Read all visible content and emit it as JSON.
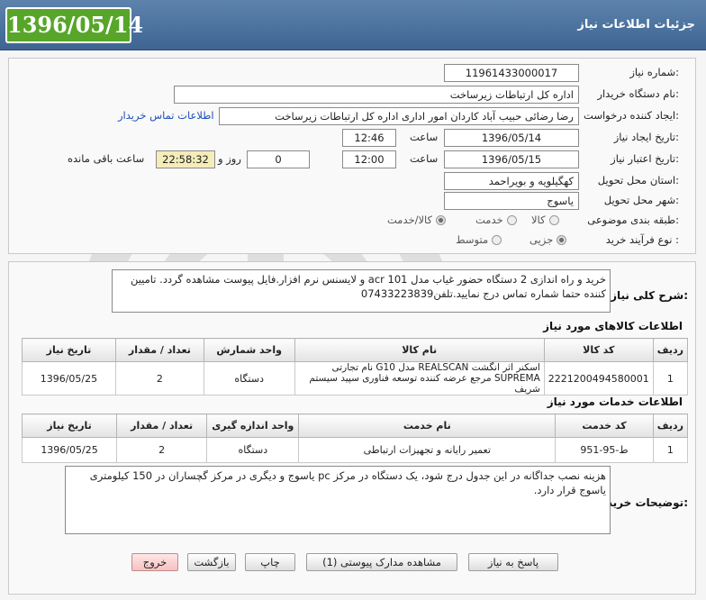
{
  "header": {
    "title": "جزئیات اطلاعات نیاز",
    "date_badge": "1396/05/14"
  },
  "form": {
    "need_number_label": "شماره نیاز:",
    "need_number": "11961433000017",
    "buyer_org_label": "نام دستگاه خریدار:",
    "buyer_org": "اداره کل ارتباطات زیرساخت",
    "requester_label": "ایجاد کننده درخواست:",
    "requester": "رضا رضائی حبیب آباد کاردان امور اداری اداره کل ارتباطات زیرساخت",
    "buyer_contact_link": "اطلاعات تماس خریدار",
    "created_label": "تاریخ ایجاد نیاز:",
    "created_date": "1396/05/14",
    "created_time_label": "ساعت",
    "created_time": "12:46",
    "deadline_label": "تاریخ اعتبار نیاز:",
    "deadline_date": "1396/05/15",
    "deadline_time_label": "ساعت",
    "deadline_time": "12:00",
    "days": "0",
    "days_label": "روز و",
    "remaining_time": "22:58:32",
    "remaining_label": "ساعت باقی مانده",
    "province_label": "استان محل تحویل:",
    "province": "کهگیلویه و بویراحمد",
    "city_label": "شهر محل تحویل:",
    "city": "یاسوج",
    "category_label": "طبقه بندی موضوعی:",
    "category_options": [
      "کالا",
      "خدمت",
      "کالا/خدمت"
    ],
    "category_selected": "کالا/خدمت",
    "purchase_process_label": "نوع فرآیند خرید :",
    "process_options": [
      "جزیی",
      "متوسط"
    ],
    "process_selected": "جزیی"
  },
  "summary": {
    "label": "شرح کلی نیاز:",
    "text": "خرید و راه اندازی 2 دستگاه حضور غیاب مدل acr 101 و لایسنس نرم افزار.فایل پیوست مشاهده گردد. تامیین کننده حتما شماره تماس درج نمایید.تلفن07433223839"
  },
  "goods": {
    "title": "اطلاعات کالاهای مورد نیاز",
    "headers": [
      "ردیف",
      "کد کالا",
      "نام کالا",
      "واحد شمارش",
      "تعداد / مقدار",
      "تاریخ نیاز"
    ],
    "rows": [
      [
        "1",
        "2221200494580001",
        "اسکنر اثر انگشت REALSCAN مدل G10 نام تجارتی SUPREMA مرجع عرضه کننده توسعه فناوری سپید سیستم شریف",
        "دستگاه",
        "2",
        "1396/05/25"
      ]
    ]
  },
  "services": {
    "title": "اطلاعات خدمات مورد نیاز",
    "headers": [
      "ردیف",
      "کد خدمت",
      "نام خدمت",
      "واحد اندازه گیری",
      "تعداد / مقدار",
      "تاریخ نیاز"
    ],
    "rows": [
      [
        "1",
        "ط-95-951",
        "تعمیر رایانه و تجهیزات ارتباطی",
        "دستگاه",
        "2",
        "1396/05/25"
      ]
    ]
  },
  "buyer_notes": {
    "label": "توضیحات خریدار:",
    "text": "هزینه نصب جداگانه در این جدول درج شود، یک دستگاه در مرکز pc یاسوج و دیگری در مرکز گچساران در 150 کیلومتری یاسوج قرار دارد."
  },
  "buttons": {
    "reply": "پاسخ به نیاز",
    "attachments": "مشاهده مدارک پیوستی (1)",
    "print": "چاپ",
    "back": "بازگشت",
    "exit": "خروج"
  },
  "colors": {
    "header_bg": "#4a7099",
    "date_badge_bg": "#57a629",
    "timer_bg": "#f4ecb9",
    "link": "#1f4fb8"
  },
  "watermark_text": "هزاره ارتباط"
}
